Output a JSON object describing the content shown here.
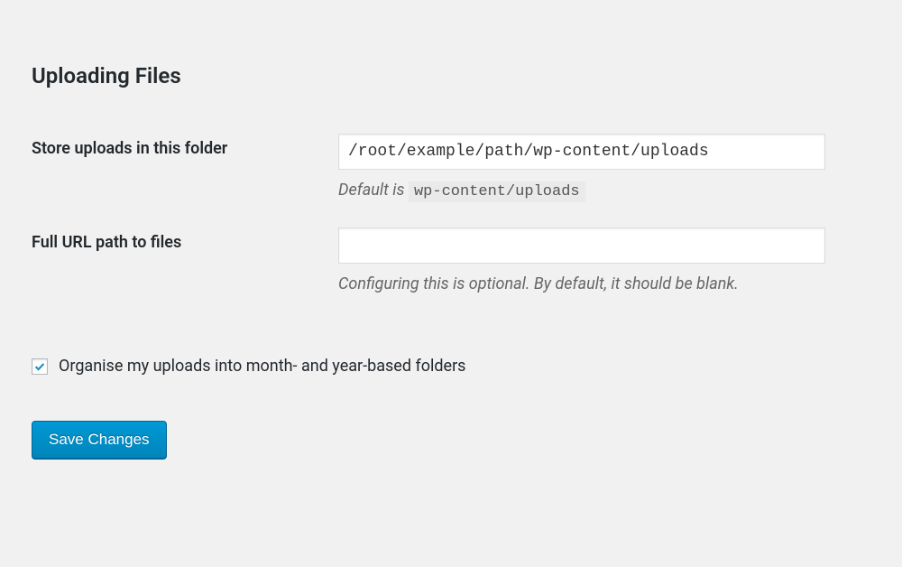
{
  "heading": "Uploading Files",
  "fields": {
    "upload_path": {
      "label": "Store uploads in this folder",
      "value": "/root/example/path/wp-content/uploads",
      "help_prefix": "Default is ",
      "help_code": "wp-content/uploads"
    },
    "url_path": {
      "label": "Full URL path to files",
      "value": "",
      "help": "Configuring this is optional. By default, it should be blank."
    }
  },
  "organize_checkbox": {
    "label": "Organise my uploads into month- and year-based folders",
    "checked": true
  },
  "submit_label": "Save Changes"
}
